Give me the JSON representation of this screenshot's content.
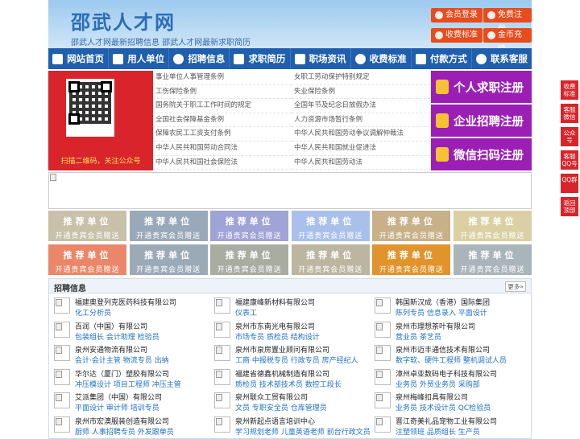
{
  "header": {
    "logo": "邵武人才网",
    "slogan": "邵武人才网最新招聘信息   邵武人才网最新求职简历",
    "buttons": [
      "会员登录",
      "免费注册",
      "收费标准",
      "金币充值"
    ]
  },
  "nav": [
    "网站首页",
    "用人单位",
    "招聘信息",
    "求职简历",
    "职场资讯",
    "收费标准",
    "付款方式",
    "联系客服"
  ],
  "qr": {
    "caption": "扫描二维码，关注公众号"
  },
  "links": [
    [
      "事业单位人事管理条例",
      "女职工劳动保护特别规定"
    ],
    [
      "工伤保险条例",
      "失业保险条例"
    ],
    [
      "国务院关于职工工作时间的规定",
      "全国年节及纪念日放假办法"
    ],
    [
      "全国社会保障基金条例",
      "人力资源市场暂行条例"
    ],
    [
      "保障农民工工资支付条例",
      "中华人民共和国劳动争议调解仲裁法"
    ],
    [
      "中华人民共和国劳动合同法",
      "中华人民共和国就业促进法"
    ],
    [
      "中华人民共和国社会保险法",
      "中华人民共和国劳动法"
    ]
  ],
  "register": [
    "个人求职注册",
    "企业招聘注册",
    "微信扫码注册"
  ],
  "recommend": {
    "title": "推荐单位",
    "sub": "开通贵宾会员赠送",
    "colors_row1": [
      "#c9c0a9",
      "#9aa9b9",
      "#9fa3d6",
      "#a9c0ea",
      "#c8b089",
      "#dad0a3"
    ],
    "colors_row2": [
      "#ea8769",
      "#9caab8",
      "#a9aca1",
      "#bcb5a0",
      "#e0942b",
      "#aab4bb"
    ]
  },
  "jobs": {
    "title": "招聘信息",
    "more": "更多»",
    "items": [
      {
        "company": "福建奥登列克医药科技有限公司",
        "titles": "化工分析员"
      },
      {
        "company": "福建康峰新材料有限公司",
        "titles": "仪表工"
      },
      {
        "company": "韩国新汉成（香港）国际集团",
        "titles": "陈列专员  信息录入  平面设计"
      },
      {
        "company": "百润（中国）有限公司",
        "titles": "包装组长  会计助理  检验员"
      },
      {
        "company": "泉州市东南光电有限公司",
        "titles": "市场专员  质检员  结构设计"
      },
      {
        "company": "泉州市理想茶叶有限公司",
        "titles": "营业员  茶艺员"
      },
      {
        "company": "泉州安通物流有限公司",
        "titles": "会计·会计主管  物流专员  出纳"
      },
      {
        "company": "泉州市泉房置业顾问有限公司",
        "titles": "工商·中报税专员  行政专员  房产经纪人"
      },
      {
        "company": "泉州市迈丰通信技术有限公司",
        "titles": "数字软、硬件工程师  整机调试人员"
      },
      {
        "company": "华尔达（厦门）塑胶有限公司",
        "titles": "冲压模设计  项目工程师  冲压主管"
      },
      {
        "company": "福建省德鑫机械制造有限公司",
        "titles": "质检员  技术部技术员  数控工段长"
      },
      {
        "company": "漳州卓亚数码电子科技有限公司",
        "titles": "业务员  外贸业务员  采购部"
      },
      {
        "company": "艾派集团（中国）有限公司",
        "titles": "平面设计  审计师  培训专员"
      },
      {
        "company": "泉州联众工贸有限公司",
        "titles": "文员  专职安全员  仓库管理员"
      },
      {
        "company": "泉州梅峰扣具有限公司",
        "titles": "业务员  技术设计员  QC检验员"
      },
      {
        "company": "泉州市宏澳服装创造有限公司",
        "titles": "厨师  人事招聘专员  外发跟单员"
      },
      {
        "company": "泉州新起点语言培训中心",
        "titles": "学习规划老师  儿童英语老师  前台行政文员"
      },
      {
        "company": "晋江奇美礼品宠物工业有限公司",
        "titles": "注塑领班  品质组长  生产员"
      }
    ]
  },
  "float": [
    "收费标准",
    "客服微信",
    "公众号",
    "客服QQ号",
    "QQ群",
    "返回顶部"
  ]
}
